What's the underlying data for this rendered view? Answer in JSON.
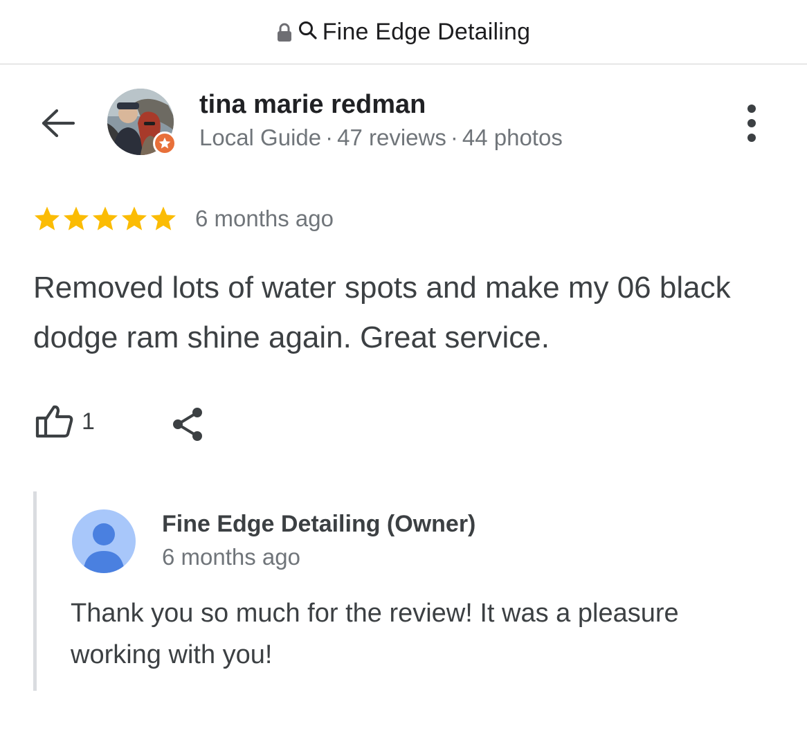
{
  "address_bar": {
    "lock_icon": "lock-icon",
    "search_icon": "search-icon",
    "title": "Fine Edge Detailing"
  },
  "reviewer": {
    "name": "tina marie redman",
    "guide_label": "Local Guide",
    "reviews": "47 reviews",
    "photos": "44 photos",
    "separator": "·",
    "badge_icon": "local-guide-star-icon"
  },
  "review": {
    "rating": 5,
    "max_rating": 5,
    "star_color": "#fbbc04",
    "date": "6 months ago",
    "text": "Removed lots of water spots and make my 06 black dodge ram shine again. Great service."
  },
  "actions": {
    "like_icon": "thumbs-up-icon",
    "like_count": "1",
    "share_icon": "share-icon"
  },
  "owner_reply": {
    "name": "Fine Edge Detailing (Owner)",
    "date": "6 months ago",
    "text": "Thank you so much for the review! It was a pleasure working with you!",
    "avatar_color": "#a8c7fa",
    "avatar_icon_color": "#4a80e0"
  },
  "colors": {
    "accent_badge": "#e8703a",
    "muted_text": "#70757a",
    "body_text": "#3c4043"
  }
}
